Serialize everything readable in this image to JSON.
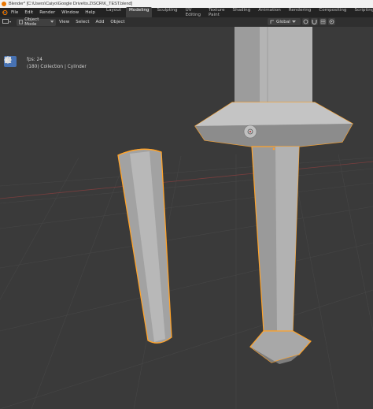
{
  "window": {
    "title": "Blender* [C:\\Users\\Caiyo\\Google Drive\\to.Z\\SCR\\K_TEST.blend]"
  },
  "menubar": {
    "items": [
      "File",
      "Edit",
      "Render",
      "Window",
      "Help"
    ],
    "workspaces": [
      "Layout",
      "Modeling",
      "Sculpting",
      "UV Editing",
      "Texture Paint",
      "Shading",
      "Animation",
      "Rendering",
      "Compositing",
      "Scripting"
    ],
    "active_workspace": "Modeling",
    "add_label": "+"
  },
  "viewport_header": {
    "mode": "Object Mode",
    "menus": [
      "View",
      "Select",
      "Add",
      "Object"
    ],
    "orientation": "Global"
  },
  "overlay": {
    "fps": "fps: 24",
    "collection": "(180) Collection | Cylinder"
  },
  "toolbar": {
    "tools": [
      "select-box-icon",
      "cursor-icon",
      "move-icon",
      "rotate-icon",
      "scale-icon",
      "transform-icon",
      "annotate-icon",
      "measure-icon"
    ],
    "active_tool": "select-box-icon"
  },
  "colors": {
    "background": "#3a3a3a",
    "selection_outline": "#ffa32a",
    "active_tab": "#3f3f3f",
    "active_tool": "#4772b3",
    "blender_orange": "#ea7600"
  }
}
